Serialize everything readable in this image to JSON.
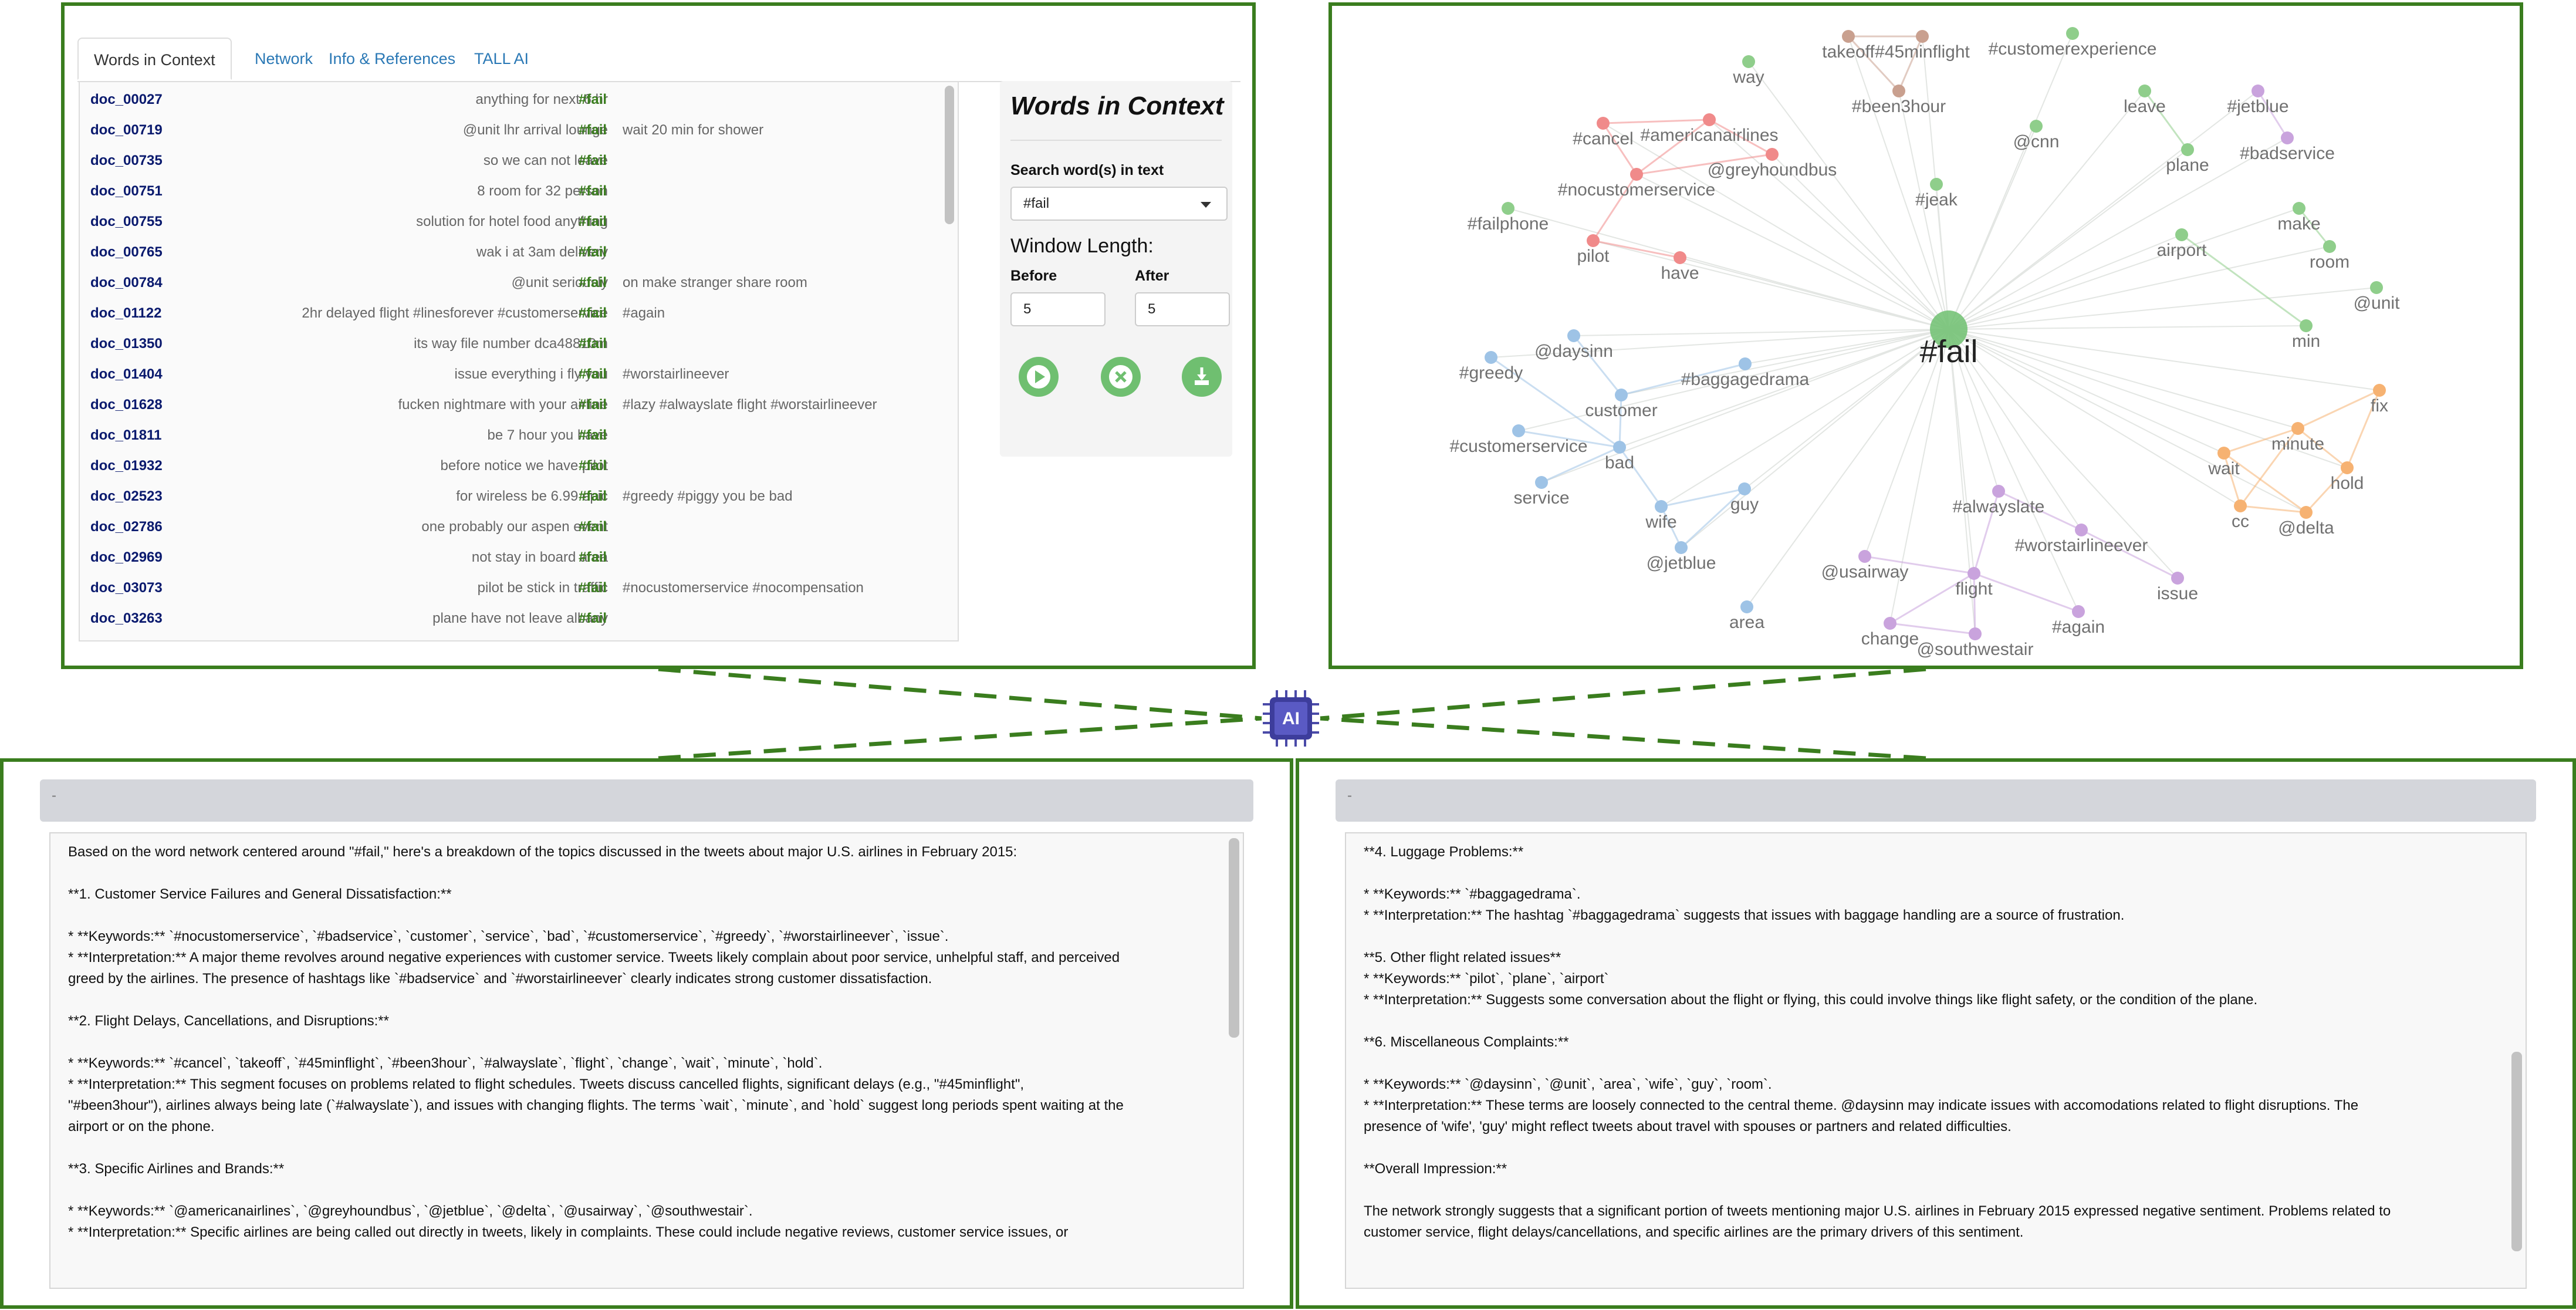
{
  "accent_color": "#3a7d1e",
  "wic": {
    "tabs": [
      "Words in Context",
      "Network",
      "Info & References",
      "TALL AI"
    ],
    "active_tab": 0,
    "rows": [
      {
        "doc": "doc_00027",
        "left": "anything for next 6 hr",
        "key": "#fail",
        "right": ""
      },
      {
        "doc": "doc_00719",
        "left": "@unit lhr arrival lounge",
        "key": "#fail",
        "right": "wait 20 min for shower"
      },
      {
        "doc": "doc_00735",
        "left": "so we can not leave",
        "key": "#fail",
        "right": ""
      },
      {
        "doc": "doc_00751",
        "left": "8 room for 32 person",
        "key": "#fail",
        "right": ""
      },
      {
        "doc": "doc_00755",
        "left": "solution for hotel food anything",
        "key": "#fail",
        "right": ""
      },
      {
        "doc": "doc_00765",
        "left": "wak i at 3am delivery",
        "key": "#fail",
        "right": ""
      },
      {
        "doc": "doc_00784",
        "left": "@unit seriously",
        "key": "#fail",
        "right": "on make stranger share room"
      },
      {
        "doc": "doc_01122",
        "left": "2hr delayed flight #linesforever #customerservice",
        "key": "#fail",
        "right": "#again"
      },
      {
        "doc": "doc_01350",
        "left": "its way file number dca48810m",
        "key": "#fail",
        "right": ""
      },
      {
        "doc": "doc_01404",
        "left": "issue everything i fly you",
        "key": "#fail",
        "right": "#worstairlineever"
      },
      {
        "doc": "doc_01628",
        "left": "fucken nightmare with your airline",
        "key": "#fail",
        "right": "#lazy #alwayslate flight #worstairlineever"
      },
      {
        "doc": "doc_01811",
        "left": "be 7 hour you have",
        "key": "#fail",
        "right": ""
      },
      {
        "doc": "doc_01932",
        "left": "before notice we have pilot",
        "key": "#fail",
        "right": ""
      },
      {
        "doc": "doc_02523",
        "left": "for wireless be 6.99 epic",
        "key": "#fail",
        "right": "#greedy #piggy you be bad"
      },
      {
        "doc": "doc_02786",
        "left": "one probably our aspen event",
        "key": "#fail",
        "right": ""
      },
      {
        "doc": "doc_02969",
        "left": "not stay in board area",
        "key": "#fail",
        "right": ""
      },
      {
        "doc": "doc_03073",
        "left": "pilot be stick in traffic",
        "key": "#fail",
        "right": "#nocustomerservice #nocompensation"
      },
      {
        "doc": "doc_03263",
        "left": "plane have not leave albany",
        "key": "#fail",
        "right": ""
      }
    ],
    "side": {
      "title": "Words in Context",
      "search_label": "Search word(s) in text",
      "search_value": "#fail",
      "window_label": "Window Length:",
      "before_label": "Before",
      "after_label": "After",
      "before_value": "5",
      "after_value": "5",
      "buttons": [
        "play-icon",
        "close-icon",
        "download-icon"
      ]
    }
  },
  "network": {
    "center_label": "#fail",
    "colors": {
      "green": "#8fce8b",
      "red": "#f08a8a",
      "blue": "#9ec3e6",
      "purple": "#c9a3dd",
      "orange": "#f6b272",
      "brown": "#c9a08f"
    },
    "nodes": [
      {
        "label": "way",
        "group": "green"
      },
      {
        "label": "takeoff",
        "group": "brown"
      },
      {
        "label": "#45minflight",
        "group": "brown"
      },
      {
        "label": "#been3hour",
        "group": "brown"
      },
      {
        "label": "#customerexperience",
        "group": "green"
      },
      {
        "label": "#cancel",
        "group": "red"
      },
      {
        "label": "#americanairlines",
        "group": "red"
      },
      {
        "label": "@greyhoundbus",
        "group": "red"
      },
      {
        "label": "#nocustomerservice",
        "group": "red"
      },
      {
        "label": "pilot",
        "group": "red"
      },
      {
        "label": "have",
        "group": "red"
      },
      {
        "label": "#failphone",
        "group": "green"
      },
      {
        "label": "@cnn",
        "group": "green"
      },
      {
        "label": "#jeak",
        "group": "green"
      },
      {
        "label": "leave",
        "group": "green"
      },
      {
        "label": "plane",
        "group": "green"
      },
      {
        "label": "#jetblue",
        "group": "purple"
      },
      {
        "label": "#badservice",
        "group": "purple"
      },
      {
        "label": "airport",
        "group": "green"
      },
      {
        "label": "make",
        "group": "green"
      },
      {
        "label": "room",
        "group": "green"
      },
      {
        "label": "@unit",
        "group": "green"
      },
      {
        "label": "min",
        "group": "green"
      },
      {
        "label": "@daysinn",
        "group": "blue"
      },
      {
        "label": "#greedy",
        "group": "blue"
      },
      {
        "label": "#baggagedrama",
        "group": "blue"
      },
      {
        "label": "customer",
        "group": "blue"
      },
      {
        "label": "#customerservice",
        "group": "blue"
      },
      {
        "label": "bad",
        "group": "blue"
      },
      {
        "label": "service",
        "group": "blue"
      },
      {
        "label": "wife",
        "group": "blue"
      },
      {
        "label": "guy",
        "group": "blue"
      },
      {
        "label": "@jetblue",
        "group": "blue"
      },
      {
        "label": "area",
        "group": "blue"
      },
      {
        "label": "#alwayslate",
        "group": "purple"
      },
      {
        "label": "#worstairlineever",
        "group": "purple"
      },
      {
        "label": "@usairway",
        "group": "purple"
      },
      {
        "label": "flight",
        "group": "purple"
      },
      {
        "label": "issue",
        "group": "purple"
      },
      {
        "label": "#again",
        "group": "purple"
      },
      {
        "label": "change",
        "group": "purple"
      },
      {
        "label": "@southwestair",
        "group": "purple"
      },
      {
        "label": "fix",
        "group": "orange"
      },
      {
        "label": "minute",
        "group": "orange"
      },
      {
        "label": "wait",
        "group": "orange"
      },
      {
        "label": "hold",
        "group": "orange"
      },
      {
        "label": "cc",
        "group": "orange"
      },
      {
        "label": "@delta",
        "group": "orange"
      }
    ]
  },
  "ai_chip_label": "AI",
  "ai_left": {
    "header": "-",
    "lines": [
      "Based on the word network centered around \"#fail,\" here's a breakdown of the topics discussed in the tweets about major U.S. airlines in February 2015:",
      "",
      "**1. Customer Service Failures and General Dissatisfaction:**",
      "",
      "*   **Keywords:** `#nocustomerservice`, `#badservice`, `customer`, `service`, `bad`, `#customerservice`, `#greedy`, `#worstairlineever`, `issue`.",
      "*   **Interpretation:**  A major theme revolves around negative experiences with customer service. Tweets likely complain about poor service, unhelpful staff, and perceived",
      "greed by the airlines.  The presence of hashtags like `#badservice` and `#worstairlineever` clearly indicates strong customer dissatisfaction.",
      "",
      "**2. Flight Delays, Cancellations, and Disruptions:**",
      "",
      "*   **Keywords:** `#cancel`, `takeoff`, `#45minflight`, `#been3hour`, `#alwayslate`, `flight`, `change`, `wait`, `minute`, `hold`.",
      "*   **Interpretation:** This segment focuses on problems related to flight schedules.  Tweets discuss cancelled flights, significant delays (e.g., \"#45minflight\",",
      "\"#been3hour\"), airlines always being late (`#alwayslate`), and issues with changing flights.  The terms `wait`, `minute`, and `hold` suggest long periods spent waiting at the",
      "airport or on the phone.",
      "",
      "**3. Specific Airlines and Brands:**",
      "",
      "*   **Keywords:** `@americanairlines`, `@greyhoundbus`, `@jetblue`, `@delta`, `@usairway`, `@southwestair`.",
      "*   **Interpretation:**  Specific airlines are being called out directly in tweets, likely in complaints. These could include negative reviews, customer service issues, or"
    ]
  },
  "ai_right": {
    "header": "-",
    "lines": [
      "**4. Luggage Problems:**",
      "",
      "*   **Keywords:** `#baggagedrama`.",
      "*   **Interpretation:** The hashtag `#baggagedrama` suggests that issues with baggage handling are a source of frustration.",
      "",
      "**5. Other flight related issues**",
      "*   **Keywords:** `pilot`, `plane`, `airport`",
      "*   **Interpretation:** Suggests some conversation about the flight or flying, this could involve things like flight safety, or the condition of the plane.",
      "",
      "**6. Miscellaneous Complaints:**",
      "",
      "*   **Keywords:** `@daysinn`, `@unit`, `area`, `wife`, `guy`, `room`.",
      "*   **Interpretation:** These terms are loosely connected to the central theme. @daysinn may indicate issues with accomodations related to flight disruptions. The",
      "presence of 'wife', 'guy' might reflect tweets about travel with spouses or partners and related difficulties.",
      "",
      "**Overall Impression:**",
      "",
      "The network strongly suggests that a significant portion of tweets mentioning major U.S. airlines in February 2015 expressed negative sentiment.  Problems related to",
      "customer service, flight delays/cancellations, and specific airlines are the primary drivers of this sentiment."
    ]
  }
}
